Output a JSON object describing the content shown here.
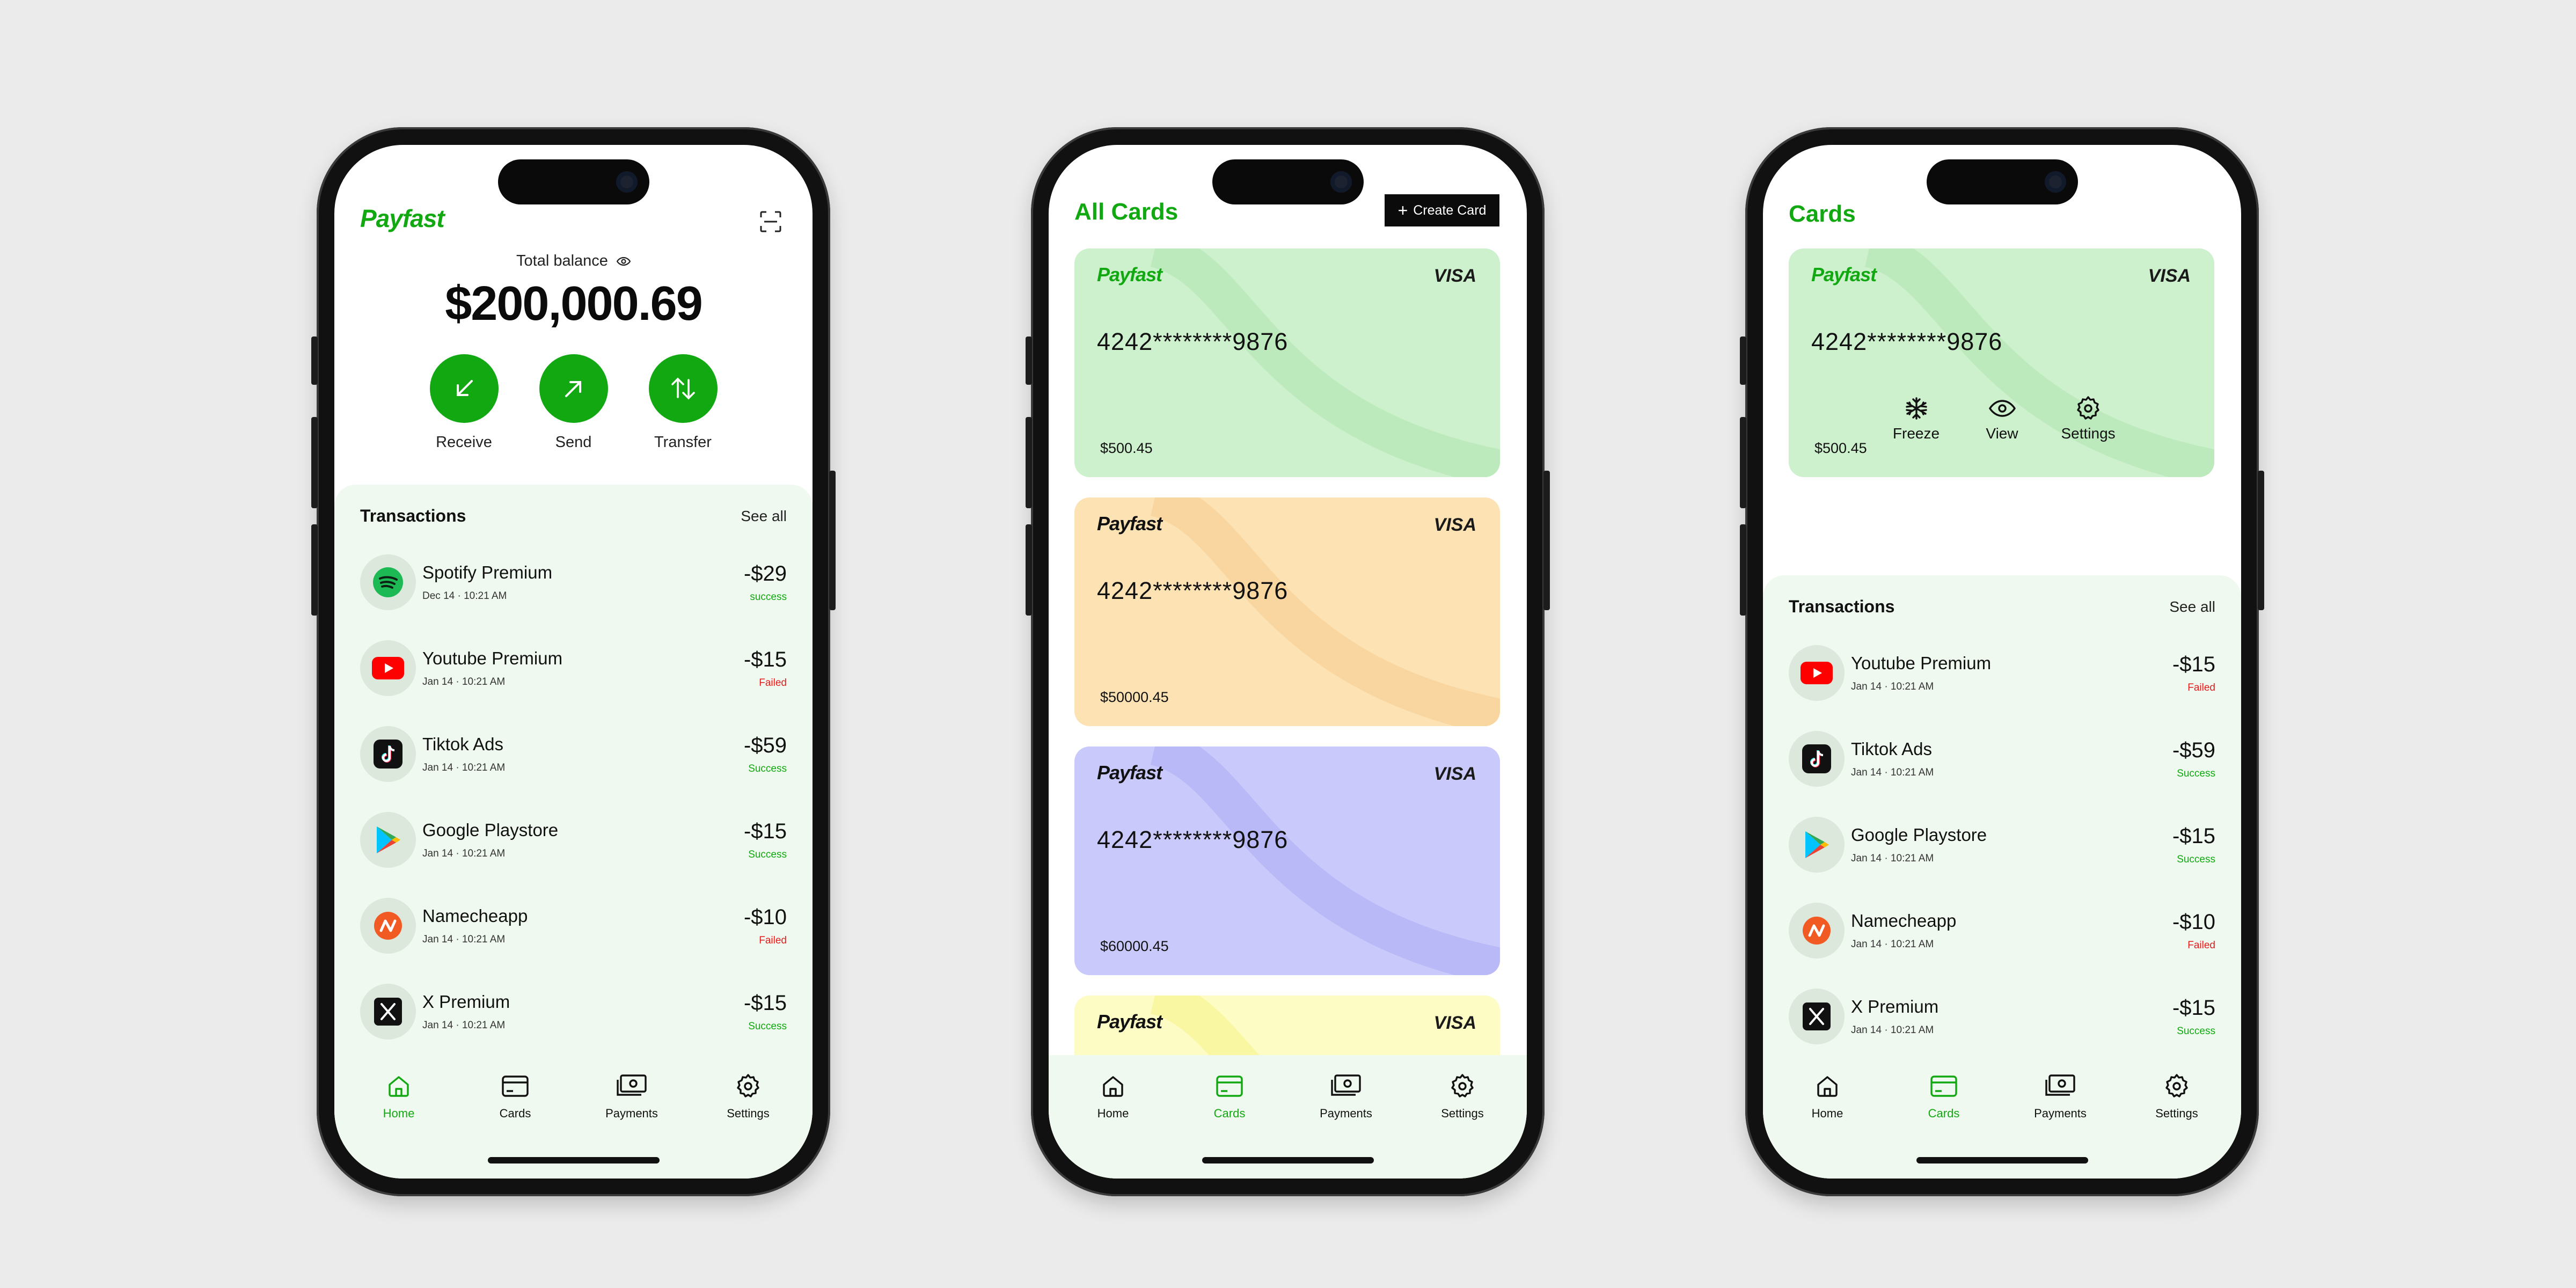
{
  "brand": {
    "name": "Payfast",
    "accent": "#12a812",
    "failed": "#e21b1b"
  },
  "screen1": {
    "logo": "Payfast",
    "balance_label": "Total balance",
    "balance_amount": "$200,000.69",
    "actions": [
      {
        "label": "Receive",
        "icon": "arrow-down-left-icon"
      },
      {
        "label": "Send",
        "icon": "arrow-up-right-icon"
      },
      {
        "label": "Transfer",
        "icon": "transfer-icon"
      }
    ],
    "transactions_title": "Transactions",
    "see_all": "See all",
    "transactions": [
      {
        "name": "Spotify Premium",
        "date": "Dec 14 · 10:21 AM",
        "amount": "-$29",
        "status": "success",
        "ok": true,
        "icon": "spotify-icon"
      },
      {
        "name": "Youtube Premium",
        "date": "Jan 14 · 10:21 AM",
        "amount": "-$15",
        "status": "Failed",
        "ok": false,
        "icon": "youtube-icon"
      },
      {
        "name": "Tiktok Ads",
        "date": "Jan 14 · 10:21 AM",
        "amount": "-$59",
        "status": "Success",
        "ok": true,
        "icon": "tiktok-icon"
      },
      {
        "name": "Google Playstore",
        "date": "Jan 14 · 10:21 AM",
        "amount": "-$15",
        "status": "Success",
        "ok": true,
        "icon": "playstore-icon"
      },
      {
        "name": "Namecheapp",
        "date": "Jan 14 · 10:21 AM",
        "amount": "-$10",
        "status": "Failed",
        "ok": false,
        "icon": "namecheap-icon"
      },
      {
        "name": "X Premium",
        "date": "Jan 14 · 10:21 AM",
        "amount": "-$15",
        "status": "Success",
        "ok": true,
        "icon": "x-icon"
      }
    ]
  },
  "screen2": {
    "title": "All Cards",
    "create_button": "Create Card",
    "cards": [
      {
        "logo": "Payfast",
        "network": "VISA",
        "number": "4242********9876",
        "balance": "$500.45",
        "color": "#cdf0cd"
      },
      {
        "logo": "Payfast",
        "network": "VISA",
        "number": "4242********9876",
        "balance": "$50000.45",
        "color": "#fde2b4"
      },
      {
        "logo": "Payfast",
        "network": "VISA",
        "number": "4242********9876",
        "balance": "$60000.45",
        "color": "#c9c9fb"
      },
      {
        "logo": "Payfast",
        "network": "VISA",
        "number": "",
        "balance": "",
        "color": "#fdfcc4"
      }
    ]
  },
  "screen3": {
    "title": "Cards",
    "card": {
      "logo": "Payfast",
      "network": "VISA",
      "number": "4242********9876",
      "balance": "$500.45"
    },
    "card_actions": [
      {
        "label": "Freeze",
        "icon": "snowflake-icon"
      },
      {
        "label": "View",
        "icon": "eye-icon"
      },
      {
        "label": "Settings",
        "icon": "gear-icon"
      }
    ],
    "transactions_title": "Transactions",
    "see_all": "See all",
    "transactions": [
      {
        "name": "Youtube Premium",
        "date": "Jan 14 · 10:21 AM",
        "amount": "-$15",
        "status": "Failed",
        "ok": false,
        "icon": "youtube-icon"
      },
      {
        "name": "Tiktok Ads",
        "date": "Jan 14 · 10:21 AM",
        "amount": "-$59",
        "status": "Success",
        "ok": true,
        "icon": "tiktok-icon"
      },
      {
        "name": "Google Playstore",
        "date": "Jan 14 · 10:21 AM",
        "amount": "-$15",
        "status": "Success",
        "ok": true,
        "icon": "playstore-icon"
      },
      {
        "name": "Namecheapp",
        "date": "Jan 14 · 10:21 AM",
        "amount": "-$10",
        "status": "Failed",
        "ok": false,
        "icon": "namecheap-icon"
      },
      {
        "name": "X Premium",
        "date": "Jan 14 · 10:21 AM",
        "amount": "-$15",
        "status": "Success",
        "ok": true,
        "icon": "x-icon"
      }
    ]
  },
  "tabbar": {
    "tabs": [
      {
        "label": "Home",
        "icon": "home-icon"
      },
      {
        "label": "Cards",
        "icon": "card-icon"
      },
      {
        "label": "Payments",
        "icon": "payments-icon"
      },
      {
        "label": "Settings",
        "icon": "gear-icon"
      }
    ],
    "active": {
      "screen1": 0,
      "screen2": 1,
      "screen3": 1
    }
  }
}
